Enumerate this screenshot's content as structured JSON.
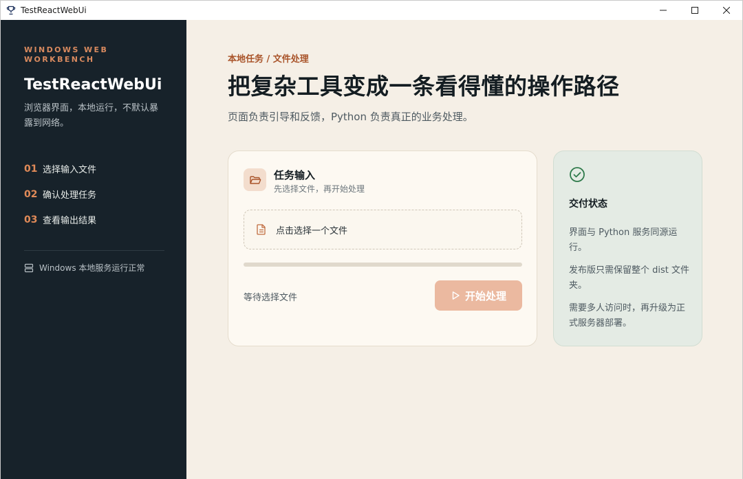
{
  "window": {
    "title": "TestReactWebUi",
    "app_icon": "trophy-icon",
    "controls": [
      "minimize-icon",
      "maximize-icon",
      "close-icon"
    ]
  },
  "sidebar": {
    "kicker": "WINDOWS WEB WORKBENCH",
    "title": "TestReactWebUi",
    "description": "浏览器界面，本地运行，不默认暴露到网络。",
    "steps": [
      {
        "num": "01",
        "label": "选择输入文件"
      },
      {
        "num": "02",
        "label": "确认处理任务"
      },
      {
        "num": "03",
        "label": "查看输出结果"
      }
    ],
    "status": "Windows 本地服务运行正常",
    "status_icon": "server-icon"
  },
  "main": {
    "breadcrumb": "本地任务 / 文件处理",
    "headline": "把复杂工具变成一条看得懂的操作路径",
    "subline": "页面负责引导和反馈，Python 负责真正的业务处理。",
    "task_card": {
      "title": "任务输入",
      "subtitle": "先选择文件，再开始处理",
      "icon": "folder-open-icon",
      "dropzone_label": "点击选择一个文件",
      "dropzone_icon": "file-text-icon",
      "progress": 0,
      "waiting_text": "等待选择文件",
      "start_button": "开始处理",
      "start_icon": "play-icon"
    },
    "status_card": {
      "title": "交付状态",
      "icon": "check-circle-icon",
      "notes": [
        "界面与 Python 服务同源运行。",
        "发布版只需保留整个 dist 文件夹。",
        "需要多人访问时，再升级为正式服务器部署。"
      ]
    }
  },
  "colors": {
    "sidebar_bg": "#17222a",
    "accent": "#d98a5f",
    "main_bg": "#f5efe6",
    "status_bg": "#e4ebe4",
    "success": "#2f7a4b"
  }
}
